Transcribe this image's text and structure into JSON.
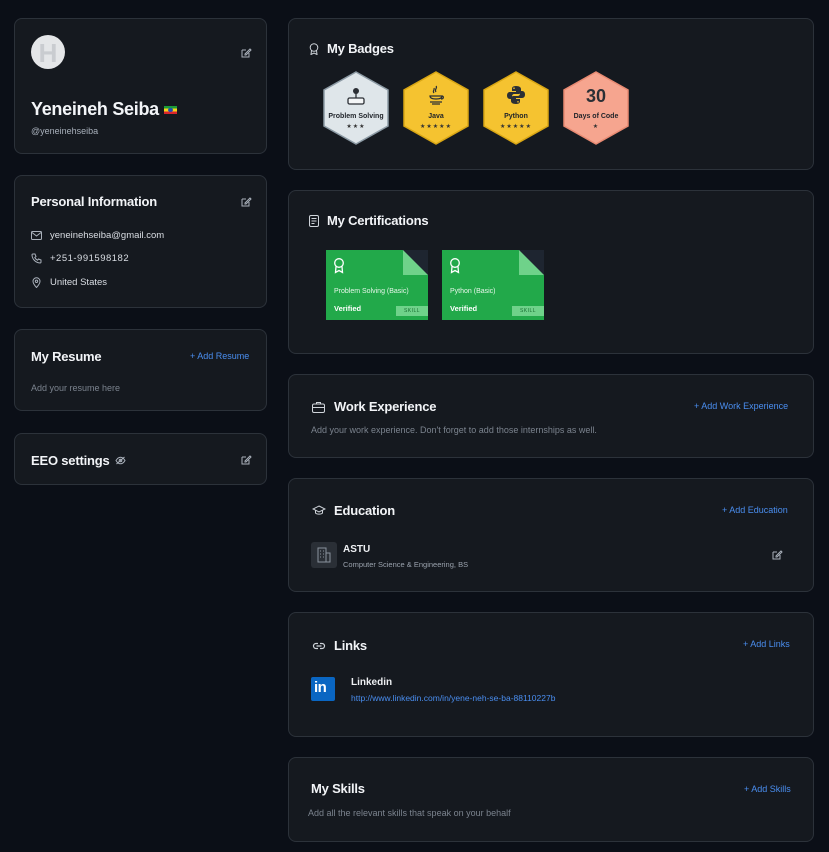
{
  "profile": {
    "name": "Yeneineh Seiba",
    "username": "@yeneinehseiba",
    "avatar_letter": "H"
  },
  "personal_info": {
    "title": "Personal Information",
    "email": "yeneinehseiba@gmail.com",
    "phone": "+251-991598182",
    "location": "United States"
  },
  "resume": {
    "title": "My Resume",
    "add_label": "+ Add Resume",
    "placeholder": "Add your resume here"
  },
  "eeo": {
    "title": "EEO settings"
  },
  "badges": {
    "title": "My Badges",
    "items": [
      {
        "label": "Problem Solving",
        "stars": "★★★",
        "color": "#dfe6ea"
      },
      {
        "label": "Java",
        "stars": "★★★★★",
        "color": "#f5c330"
      },
      {
        "label": "Python",
        "stars": "★★★★★",
        "color": "#f5c330"
      },
      {
        "number": "30",
        "label": "Days of Code",
        "stars": "★",
        "color": "#f6a58f"
      }
    ]
  },
  "certifications": {
    "title": "My Certifications",
    "items": [
      {
        "title": "Problem Solving (Basic)",
        "status": "Verified",
        "tag": "SKILL"
      },
      {
        "title": "Python (Basic)",
        "status": "Verified",
        "tag": "SKILL"
      }
    ]
  },
  "work": {
    "title": "Work Experience",
    "add_label": "+ Add Work Experience",
    "placeholder": "Add your work experience. Don't forget to add those internships as well."
  },
  "education": {
    "title": "Education",
    "add_label": "+ Add Education",
    "school": "ASTU",
    "degree": "Computer Science & Engineering, BS"
  },
  "links": {
    "title": "Links",
    "add_label": "+ Add Links",
    "name": "Linkedin",
    "url": "http://www.linkedin.com/in/yene-neh-se-ba-88110227b"
  },
  "skills": {
    "title": "My Skills",
    "add_label": "+ Add Skills",
    "placeholder": "Add all the relevant skills that speak on your behalf"
  },
  "colors": {
    "accent": "#4a8ef0",
    "card_bg": "#15191f",
    "page_bg": "#0b0f17",
    "cert_green": "#22a94a"
  }
}
